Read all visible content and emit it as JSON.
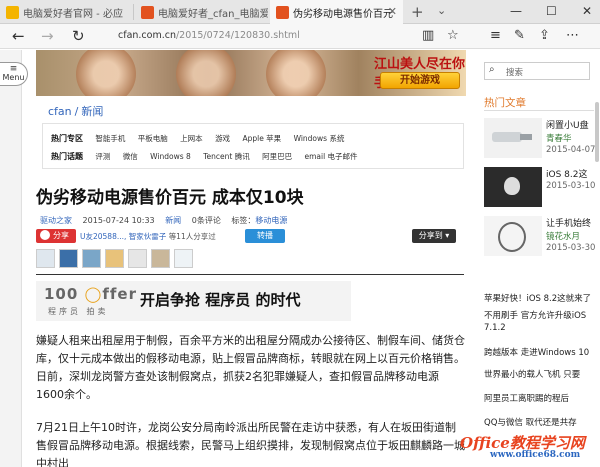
{
  "tabs": [
    {
      "title": "电脑爱好者官网 - 必应",
      "favicon_color": "#f4b400"
    },
    {
      "title": "电脑爱好者_cfan_电脑爱好者",
      "favicon_color": "#e2521f"
    },
    {
      "title": "伪劣移动电源售价百元",
      "favicon_color": "#e2521f"
    }
  ],
  "address": {
    "domain": "cfan.com.cn",
    "path": "/2015/0724/120830.shtml"
  },
  "menu_label": "Menu",
  "banner": {
    "title": "江山美人尽在你手",
    "button": "开始游戏"
  },
  "breadcrumb": [
    "cfan",
    "新闻"
  ],
  "nav_rows": [
    {
      "label": "热门专区",
      "items": [
        "智能手机",
        "平板电脑",
        "上网本",
        "游戏",
        "Apple 苹果",
        "Windows 系统"
      ]
    },
    {
      "label": "热门话题",
      "items": [
        "评测",
        "微信",
        "Windows 8",
        "Tencent 腾讯",
        "阿里巴巴",
        "email 电子邮件"
      ]
    }
  ],
  "article": {
    "title": "伪劣移动电源售价百元 成本仅10块",
    "source": "驱动之家",
    "time": "2015-07-24 10:33",
    "category": "新闻",
    "comments": "0条评论",
    "tag_label": "标签：",
    "tag": "移动电源",
    "share": "分享",
    "share_users": "U友20588...",
    "share_users2": "智家伙雷子",
    "share_count": "等11人分享过",
    "repost": "转播",
    "share_to": "分享到",
    "paragraphs": [
      "嫌疑人租来出租屋用于制假，百余平方米的出租屋分隔成办公接待区、制假车间、储货仓库，仅十元成本做出的假移动电源，贴上假冒品牌商标，转眼就在网上以百元价格销售。日前，深圳龙岗警方查处该制假窝点，抓获2名犯罪嫌疑人，查扣假冒品牌移动电源1600余个。",
      "7月21日上午10时许，龙岗公安分局南岭派出所民警在走访中获悉，有人在坂田街道制售假冒品牌移动电源。根据线索，民警马上组织摸排，发现制假窝点位于坂田麒麟路一城中村出"
    ]
  },
  "ad": {
    "logo_a": "100",
    "logo_b": "ffer",
    "logo_sub": "程序员 拍卖",
    "text": "开启争抢 程序员 的时代"
  },
  "sidebar": {
    "search_placeholder": "搜索",
    "hot_title": "热门文章",
    "hot_items": [
      {
        "title": "闲置小U盘",
        "source": "青春华",
        "date": "2015-04-07"
      },
      {
        "title": "iOS 8.2这",
        "source": "",
        "date": "2015-03-10"
      },
      {
        "title": "让手机始终",
        "source": "镜花水月",
        "date": "2015-03-30"
      }
    ],
    "list": [
      "苹果好快！iOS 8.2这就来了",
      "不用刷手 官方允许升级iOS 7.1.2",
      "跨越版本 走进Windows 10",
      "世界最小的载人飞机 只要",
      "阿里员工离职踢的程后",
      "QQ与微信 取代还是共存"
    ]
  },
  "watermark": {
    "text": "Office教程学习网",
    "url": "www.office68.com"
  }
}
